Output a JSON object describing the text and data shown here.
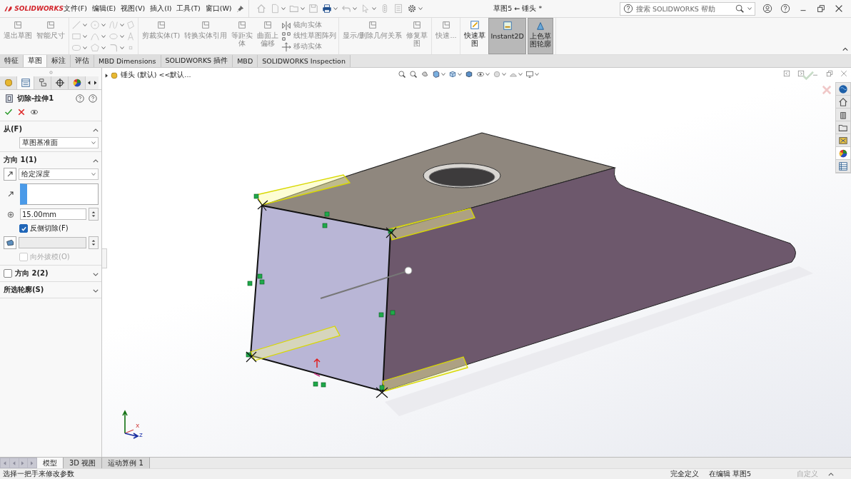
{
  "titlebar": {
    "logo": "SOLIDWORKS",
    "menus": [
      "文件(F)",
      "编辑(E)",
      "视图(V)",
      "插入(I)",
      "工具(T)",
      "窗口(W)"
    ],
    "title": "草图5 ← 锤头 *",
    "search": {
      "placeholder": "搜索 SOLIDWORKS 帮助"
    }
  },
  "ribbon": {
    "groups": [
      [
        {
          "kind": "large",
          "label": "退出草图",
          "disabled": true,
          "selected": false
        },
        {
          "kind": "large",
          "label": "智能尺寸",
          "disabled": true,
          "selected": false
        }
      ],
      [
        {
          "kind": "tool-grid",
          "disabled": true
        }
      ],
      [
        {
          "kind": "large",
          "label": "剪裁实体(T)",
          "disabled": true,
          "selected": false
        },
        {
          "kind": "large",
          "label": "转换实体引用",
          "disabled": true,
          "selected": false
        },
        {
          "kind": "large",
          "label": "等距实体",
          "disabled": true,
          "selected": false
        },
        {
          "kind": "large",
          "label": "曲面上偏移",
          "disabled": true,
          "selected": false
        },
        {
          "kind": "small-list",
          "labels": [
            "镜向实体",
            "线性草图阵列",
            "移动实体"
          ],
          "disabled": true
        }
      ],
      [
        {
          "kind": "large",
          "label": "显示/删除几何关系",
          "disabled": true,
          "selected": false
        },
        {
          "kind": "large",
          "label": "修复草图",
          "disabled": true,
          "selected": false
        }
      ],
      [
        {
          "kind": "large",
          "label": "快速...",
          "disabled": true,
          "selected": false
        }
      ],
      [
        {
          "kind": "large",
          "label": "快速草图",
          "disabled": false,
          "selected": false
        },
        {
          "kind": "large",
          "label": "Instant2D",
          "disabled": false,
          "selected": true
        },
        {
          "kind": "large",
          "label": "上色草图轮廓",
          "disabled": false,
          "selected": true
        }
      ]
    ]
  },
  "tabs": [
    {
      "label": "特征",
      "selected": false
    },
    {
      "label": "草图",
      "selected": true
    },
    {
      "label": "标注",
      "selected": false
    },
    {
      "label": "评估",
      "selected": false
    },
    {
      "label": "MBD Dimensions",
      "selected": false
    },
    {
      "label": "SOLIDWORKS 插件",
      "selected": false
    },
    {
      "label": "MBD",
      "selected": false
    },
    {
      "label": "SOLIDWORKS Inspection",
      "selected": false
    }
  ],
  "property_manager": {
    "panel_tabs": [
      {
        "selected": false
      },
      {
        "selected": true
      },
      {
        "selected": false
      },
      {
        "selected": false
      },
      {
        "selected": false
      }
    ],
    "title": "切除-拉伸1",
    "sections": [
      {
        "kind": "from",
        "title": "从(F)",
        "expanded": true,
        "start": "草图基准面"
      },
      {
        "kind": "direction",
        "title": "方向 1(1)",
        "expanded": true,
        "end_condition": "给定深度",
        "depth": "15.00mm",
        "flip": {
          "label": "反侧切除(F)",
          "checked": true
        },
        "draft_outward": {
          "label": "向外拔模(O)",
          "checked": false,
          "disabled": true
        }
      },
      {
        "kind": "optional",
        "title": "方向 2(2)",
        "expanded": false,
        "checked": false
      },
      {
        "kind": "plain",
        "title": "所选轮廓(S)",
        "expanded": false
      }
    ]
  },
  "feature_tree": {
    "label": "锤头 (默认) <<默认...",
    "expanded": false
  },
  "triad": {
    "x_label": "x",
    "z_label": "z"
  },
  "bottom_tabs": [
    {
      "label": "模型",
      "selected": true
    },
    {
      "label": "3D 视图",
      "selected": false
    },
    {
      "label": "运动算例 1",
      "selected": false
    }
  ],
  "status_bar": {
    "message": "选择一把手来修改参数",
    "sketch_state": "完全定义",
    "editing": "在编辑 草图5",
    "units": "自定义"
  }
}
